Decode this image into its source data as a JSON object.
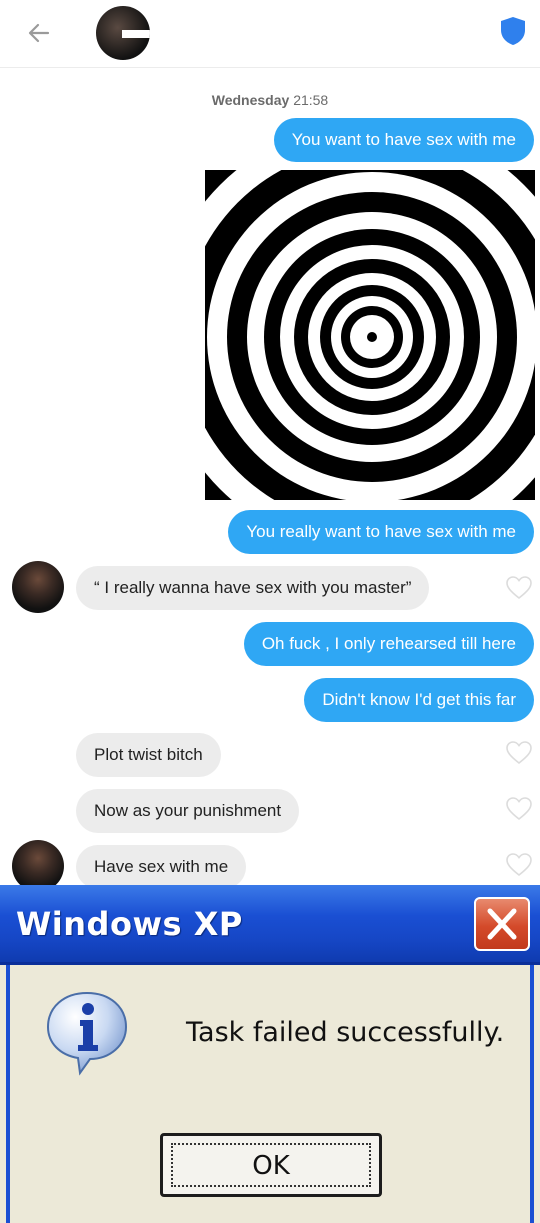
{
  "header": {
    "back_icon": "arrow-left-icon",
    "shield_icon": "shield-icon",
    "accent_color": "#2fa7f4"
  },
  "conversation": {
    "timestamp_day": "Wednesday",
    "timestamp_time": "21:58",
    "messages": [
      {
        "direction": "outgoing",
        "text": "You want to have sex with me"
      },
      {
        "direction": "outgoing",
        "type": "image",
        "image": "concentric-circles-spiral"
      },
      {
        "direction": "outgoing",
        "text": "You really want to have sex with me"
      },
      {
        "direction": "incoming",
        "text": "“ I really wanna have sex with you master”"
      },
      {
        "direction": "outgoing",
        "text": "Oh fuck , I only rehearsed till here"
      },
      {
        "direction": "outgoing",
        "text": "Didn't know I'd get this far"
      },
      {
        "direction": "incoming",
        "text": "Plot twist bitch"
      },
      {
        "direction": "incoming",
        "text": "Now as your punishment"
      },
      {
        "direction": "incoming",
        "text": "Have sex with me"
      }
    ]
  },
  "dialog": {
    "title": "Windows XP",
    "message": "Task failed successfully.",
    "ok_label": "OK",
    "icon": "information-icon",
    "close_icon": "close-icon"
  }
}
